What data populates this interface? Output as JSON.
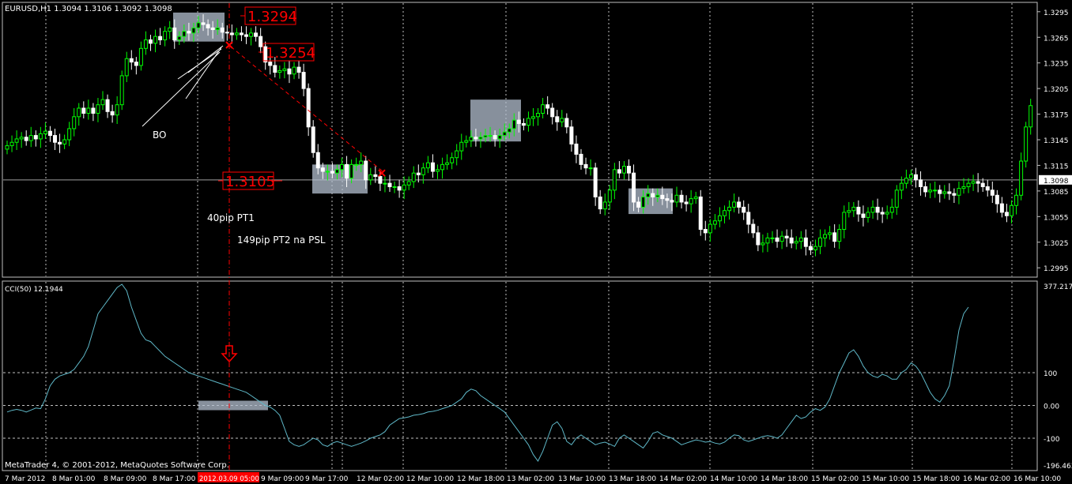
{
  "window": {
    "symbol_info": "EURUSD,H1  1.3094 1.3106 1.3092 1.3098",
    "indicator_info": "CCI(50) 12.1944",
    "copyright": "MetaTrader 4, © 2001-2012, MetaQuotes Software Corp."
  },
  "colors": {
    "background": "#000000",
    "bull_candle": "#00ff00",
    "bear_candle": "#ffffff",
    "grid": "#c0c0c0",
    "cci_line": "#5fb8c8",
    "annotation_red": "#ff0000",
    "highlight_box": "#b4c0d0"
  },
  "chart_data": [
    {
      "type": "candlestick",
      "ylim": [
        1.2985,
        1.3305
      ],
      "price_ticks": [
        "1.3295",
        "1.3265",
        "1.3235",
        "1.3205",
        "1.3175",
        "1.3145",
        "1.3115",
        "1.3085",
        "1.3055",
        "1.3025",
        "1.2995"
      ],
      "current_price": "1.3098",
      "x_ticks": [
        "7 Mar 2012",
        "8 Mar 01:00",
        "8 Mar 09:00",
        "8 Mar 17:00",
        "2012.03.09 05:00",
        "9 Mar 09:00",
        "9 Mar 17:00",
        "12 Mar 02:00",
        "12 Mar 10:00",
        "12 Mar 18:00",
        "13 Mar 02:00",
        "13 Mar 10:00",
        "13 Mar 18:00",
        "14 Mar 02:00",
        "14 Mar 10:00",
        "14 Mar 18:00",
        "15 Mar 02:00",
        "15 Mar 10:00",
        "15 Mar 18:00",
        "16 Mar 02:00",
        "16 Mar 10:00"
      ],
      "highlighted_x_tick": "2012.03.09 05:00",
      "close": [
        1.3138,
        1.3142,
        1.3146,
        1.3148,
        1.3144,
        1.315,
        1.3146,
        1.3152,
        1.3155,
        1.315,
        1.3142,
        1.314,
        1.3145,
        1.3158,
        1.3172,
        1.3182,
        1.3176,
        1.3182,
        1.3176,
        1.3186,
        1.3192,
        1.3178,
        1.3174,
        1.3186,
        1.322,
        1.324,
        1.3236,
        1.3232,
        1.3252,
        1.3262,
        1.3258,
        1.3266,
        1.3262,
        1.3272,
        1.3276,
        1.3262,
        1.3266,
        1.3272,
        1.327,
        1.3276,
        1.3282,
        1.328,
        1.3276,
        1.3274,
        1.3276,
        1.3271,
        1.327,
        1.3268,
        1.327,
        1.3268,
        1.3266,
        1.327,
        1.3266,
        1.3254,
        1.3236,
        1.3232,
        1.3224,
        1.3226,
        1.3228,
        1.3222,
        1.323,
        1.3224,
        1.3205,
        1.316,
        1.313,
        1.3112,
        1.3108,
        1.3108,
        1.3106,
        1.311,
        1.3116,
        1.31,
        1.3116,
        1.3116,
        1.312,
        1.3098,
        1.3104,
        1.3102,
        1.3094,
        1.3094,
        1.309,
        1.309,
        1.3086,
        1.3092,
        1.3096,
        1.3106,
        1.3104,
        1.3112,
        1.3118,
        1.3108,
        1.311,
        1.3116,
        1.3118,
        1.3124,
        1.3132,
        1.3142,
        1.3144,
        1.3148,
        1.3146,
        1.3148,
        1.315,
        1.315,
        1.3146,
        1.315,
        1.3154,
        1.3158,
        1.3168,
        1.3164,
        1.3162,
        1.317,
        1.3172,
        1.3176,
        1.3186,
        1.3182,
        1.3172,
        1.3166,
        1.317,
        1.316,
        1.314,
        1.3128,
        1.3116,
        1.3112,
        1.3112,
        1.3078,
        1.3064,
        1.3072,
        1.3086,
        1.311,
        1.3106,
        1.3114,
        1.3106,
        1.3072,
        1.3066,
        1.3078,
        1.3082,
        1.3078,
        1.308,
        1.3076,
        1.3074,
        1.3072,
        1.308,
        1.3072,
        1.307,
        1.3076,
        1.3078,
        1.304,
        1.3036,
        1.3046,
        1.305,
        1.3056,
        1.3062,
        1.3066,
        1.3072,
        1.3066,
        1.306,
        1.3046,
        1.3036,
        1.3022,
        1.3024,
        1.303,
        1.303,
        1.3026,
        1.3032,
        1.303,
        1.3024,
        1.3026,
        1.303,
        1.302,
        1.3016,
        1.302,
        1.303,
        1.3034,
        1.3036,
        1.3026,
        1.304,
        1.306,
        1.3062,
        1.3066,
        1.3058,
        1.3054,
        1.306,
        1.3066,
        1.306,
        1.3058,
        1.306,
        1.3066,
        1.3086,
        1.3094,
        1.31,
        1.3104,
        1.3098,
        1.309,
        1.3084,
        1.3086,
        1.3086,
        1.3082,
        1.3084,
        1.3082,
        1.308,
        1.3088,
        1.309,
        1.3094,
        1.3096,
        1.3094,
        1.309,
        1.3086,
        1.308,
        1.307,
        1.306,
        1.3056,
        1.3068,
        1.308,
        1.312,
        1.316,
        1.3185
      ],
      "annotations": {
        "price_label_1": "1.3294",
        "price_label_2": "1.3254",
        "price_label_3": "1.3105",
        "bo": "BO",
        "pt1": "40pip PT1",
        "pt2": "149pip PT2 na PSL"
      }
    },
    {
      "type": "line",
      "name": "CCI(50)",
      "ylim": [
        -196.4636,
        377.2174
      ],
      "y_ticks": [
        "377.2174",
        "100",
        "0.00",
        "-100",
        "-196.4636"
      ],
      "levels": [
        100,
        0,
        -100
      ],
      "values": [
        -20,
        -15,
        -12,
        -15,
        -20,
        -14,
        -8,
        -10,
        20,
        60,
        80,
        90,
        95,
        100,
        110,
        130,
        150,
        180,
        230,
        280,
        300,
        320,
        340,
        360,
        370,
        350,
        300,
        260,
        220,
        200,
        195,
        180,
        165,
        150,
        140,
        130,
        120,
        110,
        100,
        95,
        90,
        85,
        80,
        75,
        70,
        65,
        60,
        55,
        50,
        45,
        40,
        30,
        20,
        10,
        0,
        -5,
        -15,
        -30,
        -70,
        -110,
        -120,
        -125,
        -120,
        -110,
        -100,
        -105,
        -120,
        -125,
        -115,
        -110,
        -115,
        -120,
        -125,
        -120,
        -115,
        -108,
        -100,
        -95,
        -90,
        -80,
        -60,
        -50,
        -40,
        -38,
        -35,
        -30,
        -28,
        -25,
        -20,
        -18,
        -15,
        -10,
        -5,
        0,
        10,
        20,
        40,
        50,
        45,
        30,
        20,
        10,
        0,
        -10,
        -20,
        -40,
        -60,
        -80,
        -100,
        -120,
        -150,
        -170,
        -140,
        -100,
        -60,
        -50,
        -70,
        -110,
        -120,
        -100,
        -90,
        -100,
        -110,
        -120,
        -115,
        -112,
        -118,
        -125,
        -100,
        -90,
        -100,
        -110,
        -120,
        -130,
        -110,
        -85,
        -80,
        -90,
        -95,
        -100,
        -110,
        -120,
        -115,
        -110,
        -105,
        -108,
        -112,
        -110,
        -115,
        -118,
        -112,
        -100,
        -90,
        -92,
        -105,
        -110,
        -105,
        -100,
        -95,
        -92,
        -95,
        -100,
        -90,
        -70,
        -50,
        -30,
        -40,
        -35,
        -20,
        -10,
        -15,
        -5,
        20,
        60,
        100,
        130,
        160,
        170,
        150,
        120,
        100,
        90,
        85,
        95,
        90,
        80,
        80,
        100,
        110,
        130,
        120,
        100,
        70,
        40,
        20,
        10,
        30,
        60,
        140,
        230,
        280,
        300
      ]
    }
  ]
}
